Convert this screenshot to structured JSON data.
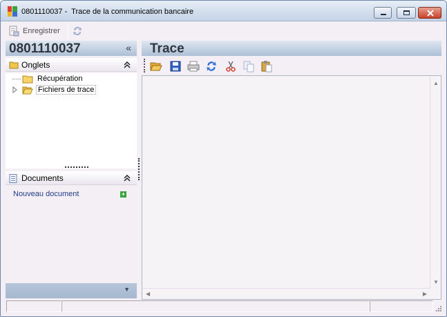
{
  "window": {
    "title": "0801110037 -  Trace de la communication bancaire",
    "minimize_icon": "minimize-icon",
    "maximize_icon": "maximize-icon",
    "close_icon": "close-icon"
  },
  "toolbar": {
    "save_label": "Enregistrer",
    "save_icon": "save-document-icon",
    "refresh_icon": "refresh-icon"
  },
  "left_panel": {
    "title": "0801110037",
    "collapse_glyph": "«",
    "sections": {
      "onglets": {
        "title": "Onglets",
        "chevron": "⌃",
        "icon": "folder-icon"
      },
      "documents": {
        "title": "Documents",
        "chevron": "⌃",
        "icon": "document-icon"
      }
    },
    "tree": [
      {
        "label": "Récupération",
        "icon": "folder-icon"
      },
      {
        "label": "Fichiers de trace",
        "icon": "open-folder-icon"
      }
    ],
    "new_document_label": "Nouveau document",
    "footer_arrow": "▼"
  },
  "right_panel": {
    "title": "Trace",
    "tools": [
      "open-folder-icon",
      "save-icon",
      "print-icon",
      "refresh-icon",
      "cut-icon",
      "copy-icon",
      "paste-icon"
    ]
  },
  "colors": {
    "window_bg": "#f3eff4",
    "header_gradient_top": "#dde6f1",
    "header_gradient_bottom": "#aec0d6",
    "link": "#1f3b8a",
    "close_button": "#c8412b",
    "add_green": "#38a13a"
  }
}
